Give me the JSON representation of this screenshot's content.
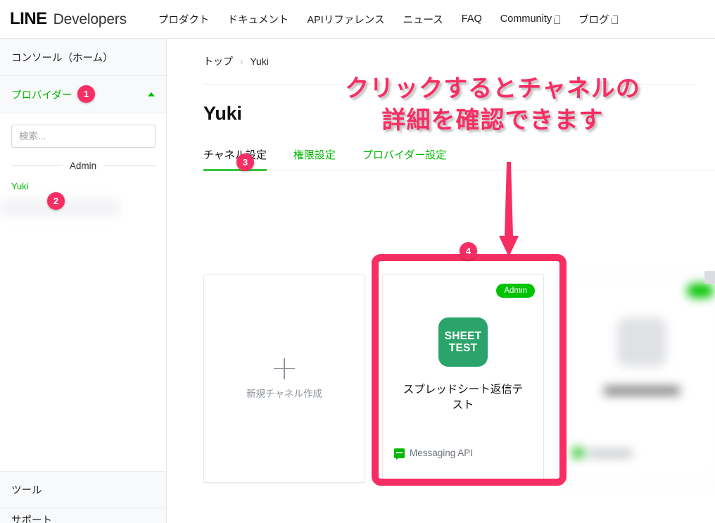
{
  "header": {
    "brand_line": "LINE",
    "brand_dev": "Developers",
    "nav": [
      {
        "label": "プロダクト",
        "external": false
      },
      {
        "label": "ドキュメント",
        "external": false
      },
      {
        "label": "APIリファレンス",
        "external": false
      },
      {
        "label": "ニュース",
        "external": false
      },
      {
        "label": "FAQ",
        "external": false
      },
      {
        "label": "Community",
        "external": true
      },
      {
        "label": "ブログ",
        "external": true
      }
    ]
  },
  "sidebar": {
    "console_home": "コンソール（ホーム）",
    "provider_label": "プロバイダー",
    "search_placeholder": "検索...",
    "search_value": "",
    "group_label": "Admin",
    "providers": [
      {
        "label": "Yuki",
        "blurred": false
      },
      {
        "label": "",
        "blurred": true
      }
    ],
    "bottom": [
      {
        "label": "ツール"
      },
      {
        "label": "サポート"
      }
    ]
  },
  "main": {
    "breadcrumb": {
      "root": "トップ",
      "separator": "›",
      "current": "Yuki"
    },
    "page_title": "Yuki",
    "tabs": [
      {
        "label": "チャネル設定",
        "active": true
      },
      {
        "label": "権限設定",
        "active": false
      },
      {
        "label": "プロバイダー設定",
        "active": false
      }
    ],
    "new_channel_label": "新規チャネル作成",
    "channel_card": {
      "badge": "Admin",
      "icon_line1": "SHEET",
      "icon_line2": "TEST",
      "name": "スプレッドシート返信テスト",
      "type": "Messaging API"
    }
  },
  "annotations": {
    "callout_line1": "クリックするとチャネルの",
    "callout_line2": "詳細を確認できます",
    "badges": [
      "1",
      "2",
      "3",
      "4"
    ],
    "accent_pink": "#f72e63",
    "accent_green": "#00b900"
  }
}
